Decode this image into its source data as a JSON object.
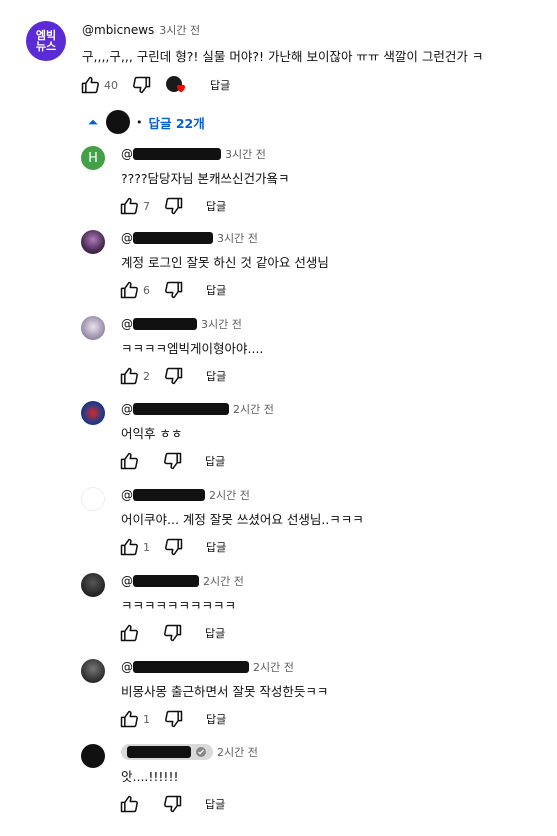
{
  "top_comment": {
    "channel": "@mbicnews",
    "time": "3시간 전",
    "text": "구,,,,구,,, 구린데 형?! 실물 머야?! 가난해 보이잖아 ㅠㅠ 색깔이 그런건가 ㅋ",
    "likes": "40",
    "reply_label": "답글",
    "avatar_text_top": "엠빅",
    "avatar_text_bottom": "뉴스",
    "avatar_color": "#5b2bd6"
  },
  "replies_toggle": {
    "label": "답글 22개",
    "separator": "•"
  },
  "replies": [
    {
      "time": "3시간 전",
      "text": "????담당자님 본캐쓰신건가욬ㅋ",
      "likes": "7",
      "reply_label": "답글",
      "avatar_letter": "H"
    },
    {
      "time": "3시간 전",
      "text": "계정 로그인 잘못 하신 것 같아요 선생님",
      "likes": "6",
      "reply_label": "답글"
    },
    {
      "time": "3시간 전",
      "text": "ㅋㅋㅋㅋ엠빅게이형아야....",
      "likes": "2",
      "reply_label": "답글"
    },
    {
      "time": "2시간 전",
      "text": "어익후 ㅎㅎ",
      "likes": "",
      "reply_label": "답글"
    },
    {
      "time": "2시간 전",
      "text": "어이쿠야... 계정 잘못 쓰셨어요 선생님..ㅋㅋㅋ",
      "likes": "1",
      "reply_label": "답글"
    },
    {
      "time": "2시간 전",
      "text": "ㅋㅋㅋㅋㅋㅋㅋㅋㅋㅋ",
      "likes": "",
      "reply_label": "답글"
    },
    {
      "time": "2시간 전",
      "text": "비몽사몽 출근하면서 잘못 작성한듯ㅋㅋ",
      "likes": "1",
      "reply_label": "답글"
    },
    {
      "time": "2시간 전",
      "text": "앗....!!!!!!",
      "likes": "",
      "reply_label": "답글"
    }
  ],
  "colors": {
    "link_blue": "#065fd4",
    "heart_red": "#ff0000",
    "muted": "#606060"
  },
  "icons": [
    "thumb-up-icon",
    "thumb-down-icon",
    "heart-icon",
    "chevron-up-icon",
    "verified-icon"
  ]
}
